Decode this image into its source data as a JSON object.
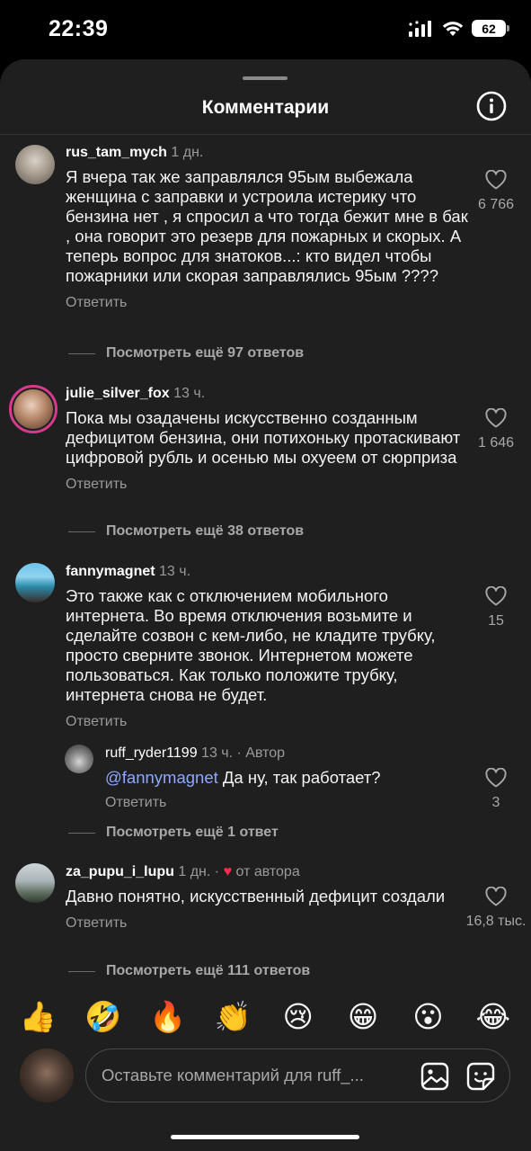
{
  "status_bar": {
    "time": "22:39",
    "battery": "62"
  },
  "sheet": {
    "title": "Комментарии"
  },
  "comments": [
    {
      "username": "rus_tam_mych",
      "time": "1 дн.",
      "text": "Я вчера так же заправлялся 95ым выбежала женщина с заправки и устроила истерику что бензина нет , я спросил а что тогда бежит мне в бак , она говорит это резерв для пожарных и скорых. А теперь вопрос для знатоков...: кто видел чтобы пожарники или скорая заправлялись 95ым ????",
      "reply_label": "Ответить",
      "likes": "6 766",
      "view_more": "Посмотреть ещё 97 ответов"
    },
    {
      "username": "julie_silver_fox",
      "time": "13 ч.",
      "text": "Пока мы озадачены искусственно созданным дефицитом бензина, они потихоньку протаскивают цифровой рубль и осенью мы охуеем от сюрприза",
      "reply_label": "Ответить",
      "likes": "1 646",
      "view_more": "Посмотреть ещё 38 ответов"
    },
    {
      "username": "fannymagnet",
      "time": "13 ч.",
      "text": "Это также как с отключением мобильного интернета. Во время отключения возьмите и сделайте созвон с кем-либо, не кладите трубку, просто сверните звонок. Интернетом можете пользоваться. Как только положите трубку, интернета снова не будет.",
      "reply_label": "Ответить",
      "likes": "15",
      "replies": [
        {
          "username": "ruff_ryder1199",
          "time": "13 ч.",
          "badge": "· Автор",
          "mention": "@fannymagnet",
          "text": " Да ну, так работает?",
          "reply_label": "Ответить",
          "likes": "3"
        }
      ],
      "view_more": "Посмотреть ещё 1 ответ"
    },
    {
      "username": "za_pupu_i_lupu",
      "time": "1 дн.",
      "author_like": "от автора",
      "text": "Давно понятно, искусственный дефицит создали",
      "reply_label": "Ответить",
      "likes": "16,8 тыс.",
      "view_more": "Посмотреть ещё 111 ответов"
    }
  ],
  "emoji_bar": [
    "👍",
    "🤣",
    "🔥",
    "👏",
    "😢",
    "😁",
    "😮",
    "😂"
  ],
  "composer": {
    "placeholder": "Оставьте комментарий для ruff_..."
  }
}
